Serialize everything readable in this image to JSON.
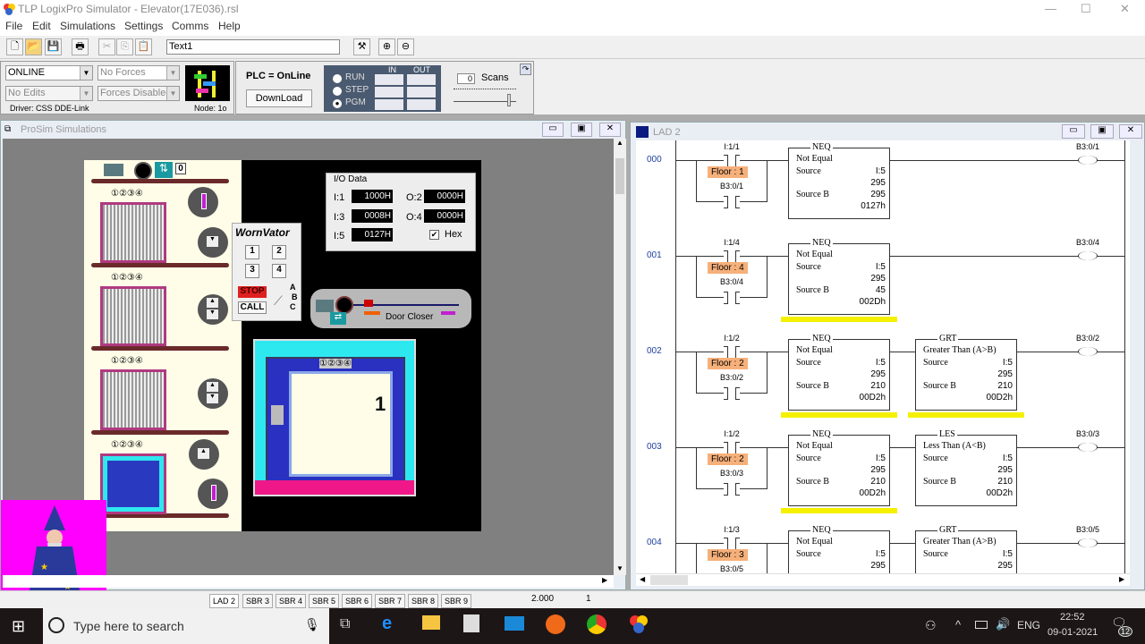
{
  "window": {
    "title": "TLP LogixPro Simulator  -  Elevator(17E036).rsl",
    "min": "—",
    "max": "☐",
    "close": "✕"
  },
  "menu": [
    "File",
    "Edit",
    "Simulations",
    "Settings",
    "Comms",
    "Help"
  ],
  "toolbar": {
    "text_field": "Text1",
    "icons": [
      "new-icon",
      "open-icon",
      "save-icon",
      "print-icon",
      "cut-icon",
      "copy-icon",
      "paste-icon"
    ]
  },
  "ctrl": {
    "mode": "ONLINE",
    "forces": "No Forces",
    "edits": "No Edits",
    "forces_enabled": "Forces Disabled",
    "driver": "Driver: CSS DDE-Link",
    "node": "Node: 1o"
  },
  "plc": {
    "status": "PLC = OnLine",
    "download": "DownLoad",
    "modes": [
      "RUN",
      "STEP",
      "PGM"
    ],
    "selected_mode": "PGM",
    "in_label": "IN",
    "out_label": "OUT",
    "scans_value": "0",
    "scans_label": "Scans"
  },
  "prosim": {
    "title": "ProSim Simulations",
    "counter": "0",
    "floor_labels": "①②③④",
    "panel_title": "WornVator",
    "buttons": [
      "1",
      "2",
      "3",
      "4"
    ],
    "stop": "STOP",
    "call": "CALL",
    "abc": [
      "A",
      "B",
      "C"
    ],
    "door_closer": "Door Closer",
    "car_floor": "1",
    "io": {
      "title": "I/O Data",
      "rows": [
        {
          "label": "I:1",
          "value": "1000H"
        },
        {
          "label": "O:2",
          "value": "0000H"
        },
        {
          "label": "I:3",
          "value": "0008H"
        },
        {
          "label": "O:4",
          "value": "0000H"
        },
        {
          "label": "I:5",
          "value": "0127H"
        }
      ],
      "hex_label": "Hex",
      "hex_checked": true
    }
  },
  "lad": {
    "title": "LAD 2",
    "rungs": [
      {
        "num": "000",
        "contact": "I:1/1",
        "floor": "Floor : 1",
        "latch": "B3:0/1",
        "coil": "B3:0/1",
        "blocks": [
          {
            "op": "NEQ",
            "name": "Not Equal",
            "src": "I:5",
            "src_val": "295",
            "srcb_val": "295",
            "srcb_hex": "0127h",
            "true": false
          }
        ]
      },
      {
        "num": "001",
        "contact": "I:1/4",
        "floor": "Floor : 4",
        "latch": "B3:0/4",
        "coil": "B3:0/4",
        "blocks": [
          {
            "op": "NEQ",
            "name": "Not Equal",
            "src": "I:5",
            "src_val": "295",
            "srcb_val": "45",
            "srcb_hex": "002Dh",
            "true": true
          }
        ]
      },
      {
        "num": "002",
        "contact": "I:1/2",
        "floor": "Floor : 2",
        "latch": "B3:0/2",
        "coil": "B3:0/2",
        "blocks": [
          {
            "op": "NEQ",
            "name": "Not Equal",
            "src": "I:5",
            "src_val": "295",
            "srcb_val": "210",
            "srcb_hex": "00D2h",
            "true": true
          },
          {
            "op": "GRT",
            "name": "Greater Than (A>B)",
            "src": "I:5",
            "src_val": "295",
            "srcb_val": "210",
            "srcb_hex": "00D2h",
            "true": true
          }
        ]
      },
      {
        "num": "003",
        "contact": "I:1/2",
        "floor": "Floor : 2",
        "latch": "B3:0/3",
        "coil": "B3:0/3",
        "blocks": [
          {
            "op": "NEQ",
            "name": "Not Equal",
            "src": "I:5",
            "src_val": "295",
            "srcb_val": "210",
            "srcb_hex": "00D2h",
            "true": true
          },
          {
            "op": "LES",
            "name": "Less Than (A<B)",
            "src": "I:5",
            "src_val": "295",
            "srcb_val": "210",
            "srcb_hex": "00D2h",
            "true": false
          }
        ]
      },
      {
        "num": "004",
        "contact": "I:1/3",
        "floor": "Floor : 3",
        "latch": "B3:0/5",
        "coil": "B3:0/5",
        "blocks": [
          {
            "op": "NEQ",
            "name": "Not Equal",
            "src": "I:5",
            "src_val": "295",
            "srcb_val": "",
            "srcb_hex": "",
            "true": false
          },
          {
            "op": "GRT",
            "name": "Greater Than (A>B)",
            "src": "I:5",
            "src_val": "295",
            "srcb_val": "",
            "srcb_hex": "",
            "true": false
          }
        ]
      }
    ]
  },
  "status": {
    "tabs": [
      "LAD 2",
      "SBR 3",
      "SBR 4",
      "SBR 5",
      "SBR 6",
      "SBR 7",
      "SBR 8",
      "SBR 9"
    ],
    "active": "LAD 2",
    "field1": "2.000",
    "field2": "1"
  },
  "taskbar": {
    "search_placeholder": "Type here to search",
    "time": "22:52",
    "date": "09-01-2021",
    "lang": "ENG",
    "notifications": "12"
  }
}
